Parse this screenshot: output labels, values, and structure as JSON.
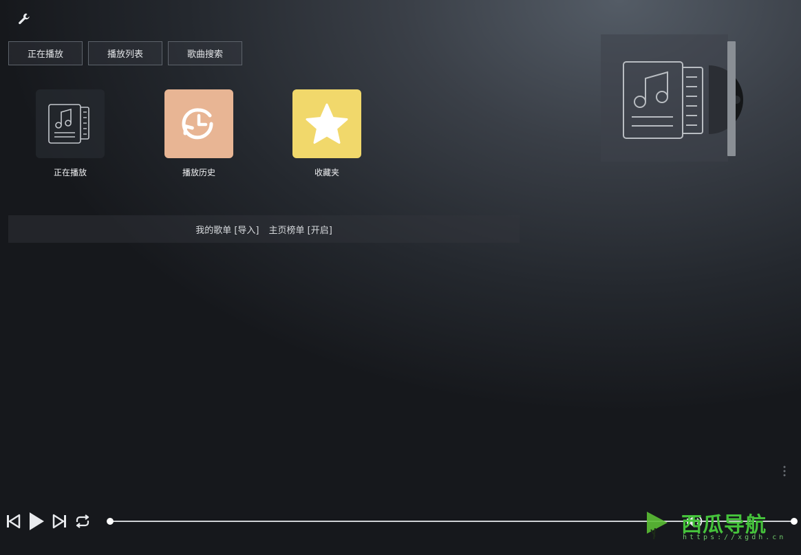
{
  "toolbar": {
    "settings_icon": "wrench-icon"
  },
  "tabs": [
    {
      "label": "正在播放"
    },
    {
      "label": "播放列表"
    },
    {
      "label": "歌曲搜索"
    }
  ],
  "tiles": [
    {
      "label": "正在播放",
      "icon": "music-document-icon",
      "color": "#2c3036"
    },
    {
      "label": "播放历史",
      "icon": "history-clock-icon",
      "color": "#e8b594"
    },
    {
      "label": "收藏夹",
      "icon": "star-icon",
      "color": "#f1d86b"
    }
  ],
  "import_bar": {
    "my_playlist": "我的歌单",
    "import_link": "[导入]",
    "home_chart": "主页榜单",
    "open_link": "[开启]"
  },
  "player": {
    "prev_icon": "previous-icon",
    "play_icon": "play-icon",
    "next_icon": "next-icon",
    "loop_icon": "repeat-icon",
    "volume_icon": "volume-icon",
    "progress": 0
  },
  "watermark": {
    "title": "西瓜导航",
    "url": "https://xgdh.cn"
  }
}
